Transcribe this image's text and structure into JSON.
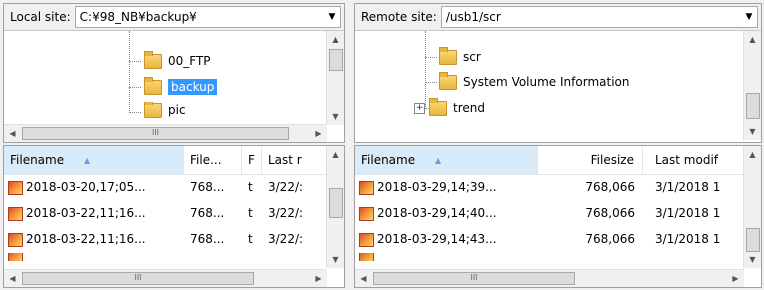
{
  "local": {
    "site_label": "Local site:",
    "site_path": "C:¥98_NB¥backup¥",
    "tree": [
      {
        "label": "00_FTP",
        "selected": false
      },
      {
        "label": "backup",
        "selected": true
      },
      {
        "label": "pic",
        "selected": false
      }
    ],
    "columns": [
      "Filename",
      "File...",
      "F",
      "Last r"
    ],
    "files": [
      {
        "name": "2018-03-20,17;05...",
        "size": "768...",
        "type": "t",
        "modified": "3/22/:"
      },
      {
        "name": "2018-03-22,11;16...",
        "size": "768...",
        "type": "t",
        "modified": "3/22/:"
      },
      {
        "name": "2018-03-22,11;16...",
        "size": "768...",
        "type": "t",
        "modified": "3/22/:"
      }
    ]
  },
  "remote": {
    "site_label": "Remote site:",
    "site_path": "/usb1/scr",
    "tree": [
      {
        "label": "scr"
      },
      {
        "label": "System Volume Information"
      },
      {
        "label": "trend",
        "expander": "+"
      }
    ],
    "columns": [
      "Filename",
      "Filesize",
      "Last modif"
    ],
    "files": [
      {
        "name": "2018-03-29,14;39...",
        "size": "768,066",
        "modified": "3/1/2018 1"
      },
      {
        "name": "2018-03-29,14;40...",
        "size": "768,066",
        "modified": "3/1/2018 1"
      },
      {
        "name": "2018-03-29,14;43...",
        "size": "768,066",
        "modified": "3/1/2018 1"
      }
    ]
  },
  "scrollbar": {
    "thumb_grip": "III"
  },
  "icons": {
    "dropdown": "chevron-down-icon",
    "folder": "folder-icon",
    "file": "image-file-icon"
  }
}
